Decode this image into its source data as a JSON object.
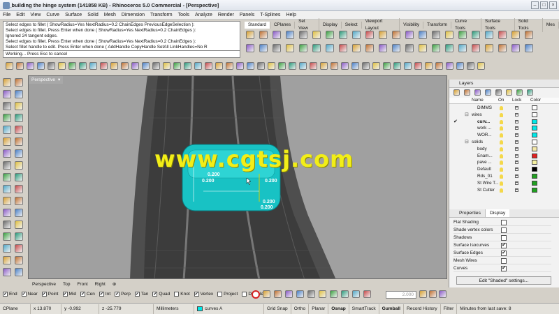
{
  "window": {
    "title": "16_building the hinge system (141858 KB) - Rhinoceros 5.0 Commercial - [Perspective]"
  },
  "menu": [
    "File",
    "Edit",
    "View",
    "Curve",
    "Surface",
    "Solid",
    "Mesh",
    "Dimension",
    "Transform",
    "Tools",
    "Analyze",
    "Render",
    "Panels",
    "T-Splines",
    "Help"
  ],
  "command_history": [
    "Select edges to fillet ( ShowRadius=Yes  NextRadius=0.2  ChainEdges  PreviousEdgeSelection ):",
    "Select edges to fillet. Press Enter when done ( ShowRadius=Yes  NextRadius=0.2  ChainEdges ):",
    "Ignored 24 tangent edges.",
    "Select edges to fillet. Press Enter when done ( ShowRadius=Yes  NextRadius=0.2  ChainEdges ):",
    "Select fillet handle to edit. Press Enter when done ( AddHandle  CopyHandle  SetAll  LinkHandles=No  R"
  ],
  "command_prompt": "Working... Press Esc to cancel",
  "toolbar_tabs": [
    "Standard",
    "CPlanes",
    "Set View",
    "Display",
    "Select",
    "Viewport Layout",
    "Visibility",
    "Transform",
    "Curve Tools",
    "Surface Tools",
    "Solid Tools",
    "Mes"
  ],
  "viewport": {
    "title": "Perspective",
    "watermark": "www.cgtsj.com",
    "fillet_labels": [
      "0.200",
      "0.200",
      "0.200",
      "0.200",
      "0.200"
    ]
  },
  "view_tabs": [
    "Perspective",
    "Top",
    "Front",
    "Right"
  ],
  "osnaps": [
    {
      "label": "End",
      "checked": true
    },
    {
      "label": "Near",
      "checked": true
    },
    {
      "label": "Point",
      "checked": true
    },
    {
      "label": "Mid",
      "checked": true
    },
    {
      "label": "Cen",
      "checked": true
    },
    {
      "label": "Int",
      "checked": true
    },
    {
      "label": "Perp",
      "checked": true
    },
    {
      "label": "Tan",
      "checked": true
    },
    {
      "label": "Quad",
      "checked": true
    },
    {
      "label": "Knot",
      "checked": false
    },
    {
      "label": "Vertex",
      "checked": true
    },
    {
      "label": "Project",
      "checked": false
    },
    {
      "label": "Disable",
      "checked": false
    }
  ],
  "status": {
    "cplane": "CPlane",
    "x": "x 13.870",
    "y": "y -0.992",
    "z": "z -25.779",
    "units": "Millimeters",
    "layer": "curves A",
    "grid_snap": "Grid Snap",
    "ortho": "Ortho",
    "planar": "Planar",
    "osnap": "Osnap",
    "smarttrack": "SmartTrack",
    "gumball": "Gumball",
    "record": "Record History",
    "filter": "Filter",
    "save": "Minutes from last save: 8",
    "tolerance": "2.000"
  },
  "layers_panel": {
    "title": "Layers",
    "headers": {
      "name": "Name",
      "on": "On",
      "lock": "Lock",
      "color": "Color"
    },
    "rows": [
      {
        "name": "DIMMS",
        "color": "#ffffff"
      },
      {
        "name": "wires",
        "color": "#ffffff",
        "group": true
      },
      {
        "name": "curv...",
        "color": "#00e8e8",
        "current": true
      },
      {
        "name": "work ...",
        "color": "#00e8e8"
      },
      {
        "name": "WOR...",
        "color": "#00e8e8"
      },
      {
        "name": "solids",
        "color": "#ffffff",
        "group": true
      },
      {
        "name": "body",
        "color": "#f4e8a8"
      },
      {
        "name": "Enam...",
        "color": "#e02020"
      },
      {
        "name": "pave ...",
        "color": "#f4f0a0"
      },
      {
        "name": "Default",
        "color": "#000000"
      },
      {
        "name": "Rds_01",
        "color": "#20a020"
      },
      {
        "name": "St Wire T...",
        "color": "#20a020"
      },
      {
        "name": "St Cutter",
        "color": "#20a020"
      }
    ]
  },
  "properties_tab": "Properties",
  "display_tab": "Display",
  "display_rows": [
    {
      "label": "Flat Shading",
      "checked": false
    },
    {
      "label": "Shade vertex colors",
      "checked": false
    },
    {
      "label": "Shadows",
      "checked": false
    },
    {
      "label": "Surface Isocurves",
      "checked": true
    },
    {
      "label": "Surface Edges",
      "checked": true
    },
    {
      "label": "Mesh Wires",
      "checked": false
    },
    {
      "label": "Curves",
      "checked": true
    }
  ],
  "edit_button": "Edit \"Shaded\" settings..."
}
